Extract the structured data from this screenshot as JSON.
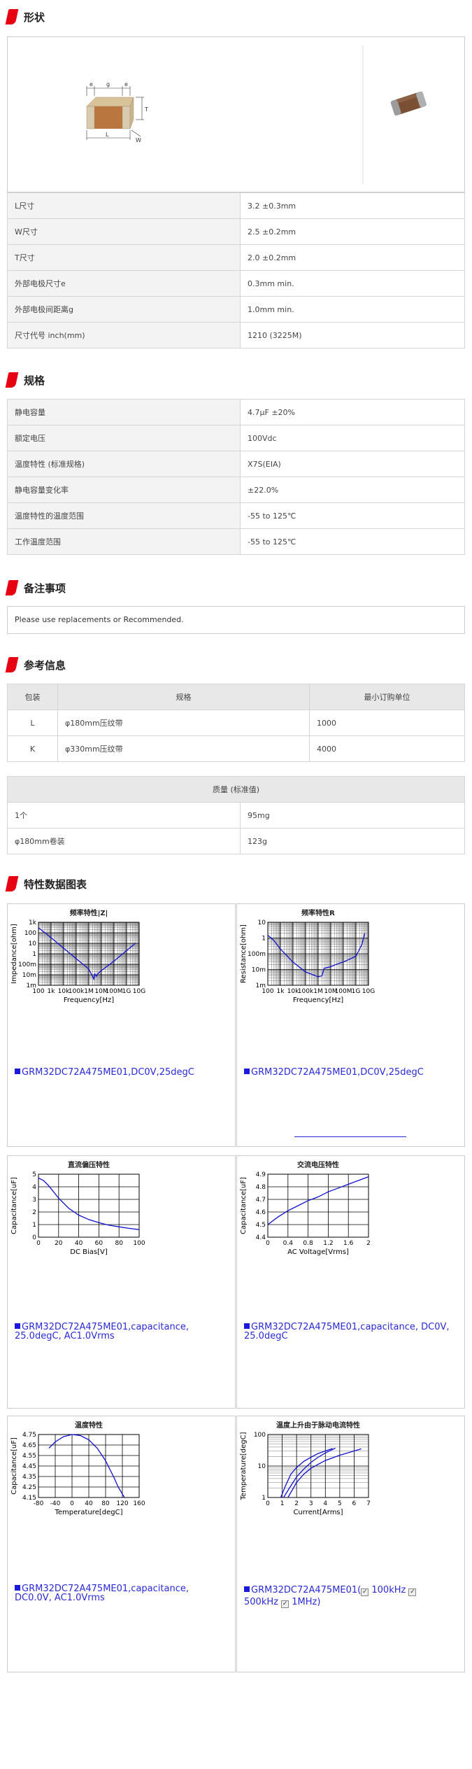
{
  "sections": {
    "shape": "形状",
    "spec": "规格",
    "notes": "备注事项",
    "reference": "参考信息",
    "charts": "特性数据图表"
  },
  "drawing_labels": {
    "e1": "e",
    "g": "g",
    "e2": "e",
    "t": "T",
    "l": "L",
    "w": "W"
  },
  "dimensions": [
    {
      "label": "L尺寸",
      "value": "3.2 ±0.3mm"
    },
    {
      "label": "W尺寸",
      "value": "2.5 ±0.2mm"
    },
    {
      "label": "T尺寸",
      "value": "2.0 ±0.2mm"
    },
    {
      "label": "外部电极尺寸e",
      "value": "0.3mm min."
    },
    {
      "label": "外部电极间距离g",
      "value": "1.0mm min."
    },
    {
      "label": "尺寸代号 inch(mm)",
      "value": "1210 (3225M)"
    }
  ],
  "specs": [
    {
      "label": "静电容量",
      "value": "4.7μF ±20%"
    },
    {
      "label": "额定电压",
      "value": "100Vdc"
    },
    {
      "label": "温度特性 (标准规格)",
      "value": "X7S(EIA)"
    },
    {
      "label": "静电容量变化率",
      "value": "±22.0%"
    },
    {
      "label": "温度特性的温度范围",
      "value": "-55 to 125℃"
    },
    {
      "label": "工作温度范围",
      "value": "-55 to 125℃"
    }
  ],
  "notes_text": "Please use replacements or Recommended.",
  "packaging": {
    "headers": [
      "包装",
      "规格",
      "最小订购单位"
    ],
    "rows": [
      {
        "code": "L",
        "spec": "φ180mm压纹带",
        "min": "1000"
      },
      {
        "code": "K",
        "spec": "φ330mm压纹带",
        "min": "4000"
      }
    ]
  },
  "mass": {
    "header": "质量 (标准值)",
    "rows": [
      {
        "label": "1个",
        "value": "95mg"
      },
      {
        "label": "φ180mm卷装",
        "value": "123g"
      }
    ]
  },
  "chart_data": [
    {
      "type": "line",
      "title": "频率特性|Z|",
      "xlabel": "Frequency[Hz]",
      "ylabel": "Impedance[ohm]",
      "x_scale": "log",
      "y_scale": "log",
      "xlim": [
        100,
        10000000000
      ],
      "ylim": [
        0.001,
        1000
      ],
      "x_ticks": [
        "100",
        "1k",
        "10k",
        "100k",
        "1M",
        "10M",
        "100M",
        "1G",
        "10G"
      ],
      "y_ticks": [
        "1k",
        "100",
        "10",
        "1",
        "100m",
        "10m",
        "1m"
      ],
      "series": [
        {
          "x": [
            100,
            1000,
            10000,
            100000,
            1000000,
            2500000,
            3000000,
            4000000,
            5000000,
            10000000,
            100000000,
            1000000000,
            5000000000
          ],
          "y": [
            300,
            34,
            3.4,
            0.34,
            0.035,
            0.004,
            0.012,
            0.007,
            0.012,
            0.025,
            0.2,
            2,
            10
          ]
        }
      ],
      "legend": "GRM32DC72A475ME01,DC0V,25degC"
    },
    {
      "type": "line",
      "title": "频率特性R",
      "xlabel": "Frequency[Hz]",
      "ylabel": "Resistance[ohm]",
      "x_scale": "log",
      "y_scale": "log",
      "xlim": [
        100,
        10000000000
      ],
      "ylim": [
        0.001,
        10
      ],
      "x_ticks": [
        "100",
        "1k",
        "10k",
        "100k",
        "1M",
        "10M",
        "100M",
        "1G",
        "10G"
      ],
      "y_ticks": [
        "10",
        "1",
        "100m",
        "10m",
        "1m"
      ],
      "series": [
        {
          "x": [
            100,
            300,
            1000,
            10000,
            100000,
            1000000,
            2000000,
            3000000,
            10000000,
            30000000,
            100000000,
            1000000000,
            3000000000,
            5000000000
          ],
          "y": [
            1.5,
            0.7,
            0.2,
            0.03,
            0.007,
            0.0035,
            0.004,
            0.012,
            0.015,
            0.022,
            0.03,
            0.07,
            0.4,
            2
          ]
        }
      ],
      "legend": "GRM32DC72A475ME01,DC0V,25degC"
    },
    {
      "type": "line",
      "title": "直流偏压特性",
      "xlabel": "DC Bias[V]",
      "ylabel": "Capacitance[uF]",
      "xlim": [
        0,
        100
      ],
      "ylim": [
        0,
        5
      ],
      "x_ticks": [
        "0",
        "20",
        "40",
        "60",
        "80",
        "100"
      ],
      "y_ticks": [
        "5",
        "4",
        "3",
        "2",
        "1",
        "0"
      ],
      "series": [
        {
          "x": [
            0,
            5,
            10,
            20,
            30,
            40,
            50,
            60,
            70,
            80,
            90,
            100
          ],
          "y": [
            4.7,
            4.5,
            4.1,
            3.1,
            2.3,
            1.75,
            1.4,
            1.15,
            0.95,
            0.82,
            0.7,
            0.6
          ]
        }
      ],
      "legend": "GRM32DC72A475ME01,capacitance, 25.0degC, AC1.0Vrms"
    },
    {
      "type": "line",
      "title": "交流电压特性",
      "xlabel": "AC Voltage[Vrms]",
      "ylabel": "Capacitance[uF]",
      "xlim": [
        0,
        2
      ],
      "ylim": [
        4.4,
        4.9
      ],
      "x_ticks": [
        "0",
        "0.4",
        "0.8",
        "1.2",
        "1.6",
        "2"
      ],
      "y_ticks": [
        "4.9",
        "4.8",
        "4.7",
        "4.6",
        "4.5",
        "4.4"
      ],
      "series": [
        {
          "x": [
            0,
            0.2,
            0.4,
            0.6,
            0.8,
            1.0,
            1.2,
            1.4,
            1.6,
            1.8,
            2.0
          ],
          "y": [
            4.5,
            4.56,
            4.61,
            4.65,
            4.69,
            4.72,
            4.76,
            4.79,
            4.82,
            4.85,
            4.88
          ]
        }
      ],
      "legend": "GRM32DC72A475ME01,capacitance, DC0V, 25.0degC"
    },
    {
      "type": "line",
      "title": "温度特性",
      "xlabel": "Temperature[degC]",
      "ylabel": "Capacitance[uF]",
      "xlim": [
        -80,
        160
      ],
      "ylim": [
        4.15,
        4.75
      ],
      "x_ticks": [
        "-80",
        "-40",
        "0",
        "40",
        "80",
        "120",
        "160"
      ],
      "y_ticks": [
        "4.75",
        "4.65",
        "4.55",
        "4.45",
        "4.35",
        "4.25",
        "4.15"
      ],
      "series": [
        {
          "x": [
            -55,
            -40,
            -20,
            0,
            20,
            40,
            60,
            80,
            100,
            110,
            125
          ],
          "y": [
            4.62,
            4.68,
            4.73,
            4.75,
            4.74,
            4.7,
            4.62,
            4.5,
            4.34,
            4.25,
            4.15
          ]
        }
      ],
      "legend": "GRM32DC72A475ME01,capacitance, DC0.0V, AC1.0Vrms"
    },
    {
      "type": "line",
      "title": "温度上升由于脉动电流特性",
      "xlabel": "Current[Arms]",
      "ylabel": "Temperature[degC]",
      "y_scale": "log",
      "xlim": [
        0,
        7
      ],
      "ylim": [
        1,
        100
      ],
      "x_ticks": [
        "0",
        "1",
        "2",
        "3",
        "4",
        "5",
        "6",
        "7"
      ],
      "y_ticks": [
        "100",
        "10",
        "1"
      ],
      "series": [
        {
          "name": "100kHz",
          "x": [
            1.1,
            1.5,
            2.0,
            2.5,
            3.0,
            3.5,
            4.0,
            4.7
          ],
          "y": [
            1,
            2.0,
            4.5,
            8,
            13,
            19,
            26,
            37
          ]
        },
        {
          "name": "500kHz",
          "x": [
            0.9,
            1.2,
            1.6,
            2.0,
            2.5,
            3.0,
            3.5,
            4.0,
            4.5
          ],
          "y": [
            1,
            2.2,
            5.5,
            9,
            14,
            19,
            25,
            30,
            36
          ]
        },
        {
          "name": "1MHz",
          "x": [
            1.4,
            2.0,
            2.5,
            3.0,
            4.0,
            5.0,
            6.0,
            6.5
          ],
          "y": [
            1,
            3.0,
            5.5,
            8.5,
            15,
            22,
            30,
            35
          ]
        }
      ],
      "legend": "GRM32DC72A475ME01(",
      "legend_options": [
        "100kHz",
        "500kHz",
        "1MHz)"
      ]
    }
  ]
}
